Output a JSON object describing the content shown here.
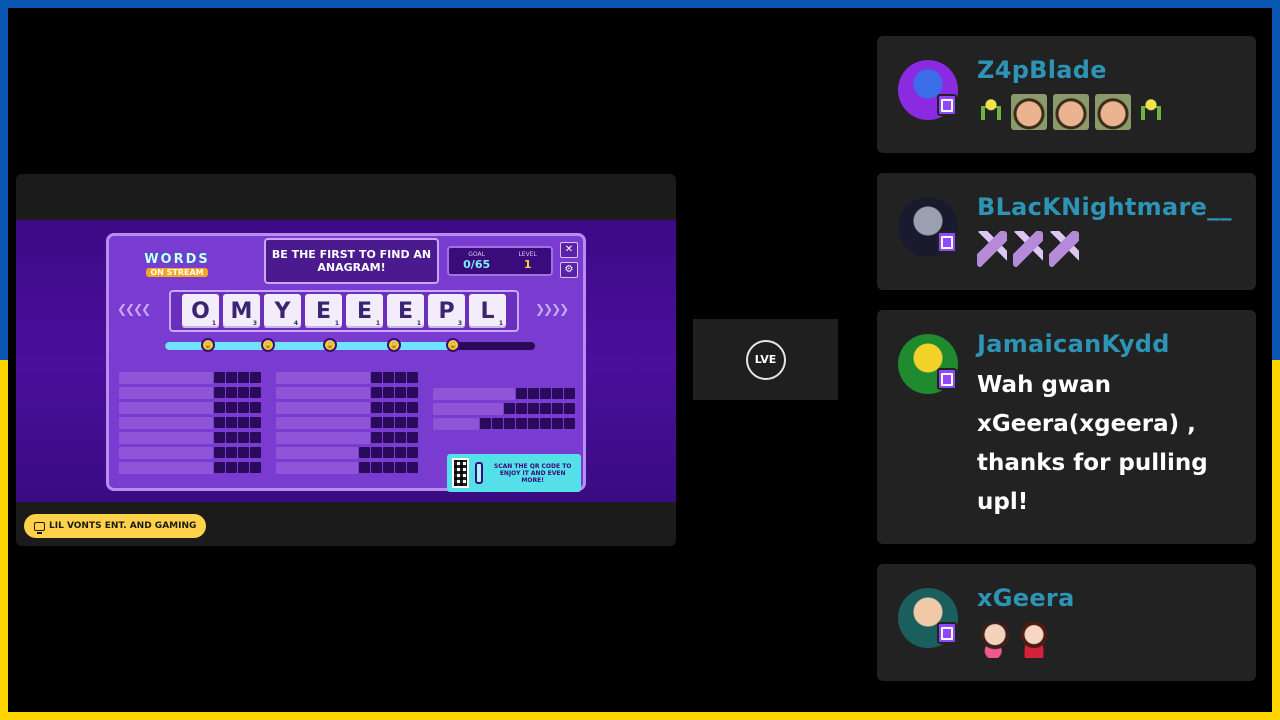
{
  "game": {
    "logo_words": "WORDS",
    "logo_stream": "ON STREAM",
    "prompt": "BE THE FIRST TO FIND AN ANAGRAM!",
    "goal_label": "GOAL",
    "goal_value": "0/65",
    "level_label": "LEVEL",
    "level_value": "1",
    "close_glyph": "✕",
    "settings_glyph": "⚙",
    "tiles": [
      {
        "letter": "O",
        "points": "1"
      },
      {
        "letter": "M",
        "points": "3"
      },
      {
        "letter": "Y",
        "points": "4"
      },
      {
        "letter": "E",
        "points": "1"
      },
      {
        "letter": "E",
        "points": "1"
      },
      {
        "letter": "E",
        "points": "1"
      },
      {
        "letter": "P",
        "points": "3"
      },
      {
        "letter": "L",
        "points": "1"
      }
    ],
    "progress_fraction": 0.78,
    "qr_text": "SCAN THE QR CODE TO ENJOY IT AND EVEN MORE!"
  },
  "channel": {
    "name": "LIL VONTS ENT. AND GAMING",
    "icon": "tv-icon"
  },
  "live": {
    "label": "LVE"
  },
  "chat": [
    {
      "username": "Z4pBlade",
      "message": "",
      "emotes": [
        "figure",
        "face",
        "face",
        "face",
        "figure"
      ],
      "avatar_colors": [
        "#8a2be2",
        "#3a6ee8"
      ]
    },
    {
      "username": "BLacKNightmare__",
      "message": "",
      "emotes": [
        "hand",
        "hand",
        "hand"
      ],
      "avatar_colors": [
        "#1a1a2e",
        "#9aa0b0"
      ]
    },
    {
      "username": "JamaicanKydd",
      "message": "Wah gwan xGeera(xgeera) , thanks for pulling upl!",
      "emotes": [],
      "avatar_colors": [
        "#1f8a2e",
        "#f2d12a"
      ]
    },
    {
      "username": "xGeera",
      "message": "",
      "emotes": [
        "kiss",
        "chibi"
      ],
      "avatar_colors": [
        "#1b5e5e",
        "#f0c9a8"
      ]
    }
  ],
  "colors": {
    "username": "#2e94b5",
    "twitch": "#9146ff",
    "top_band": "#0a58b4",
    "bottom_band": "#ffd500"
  }
}
